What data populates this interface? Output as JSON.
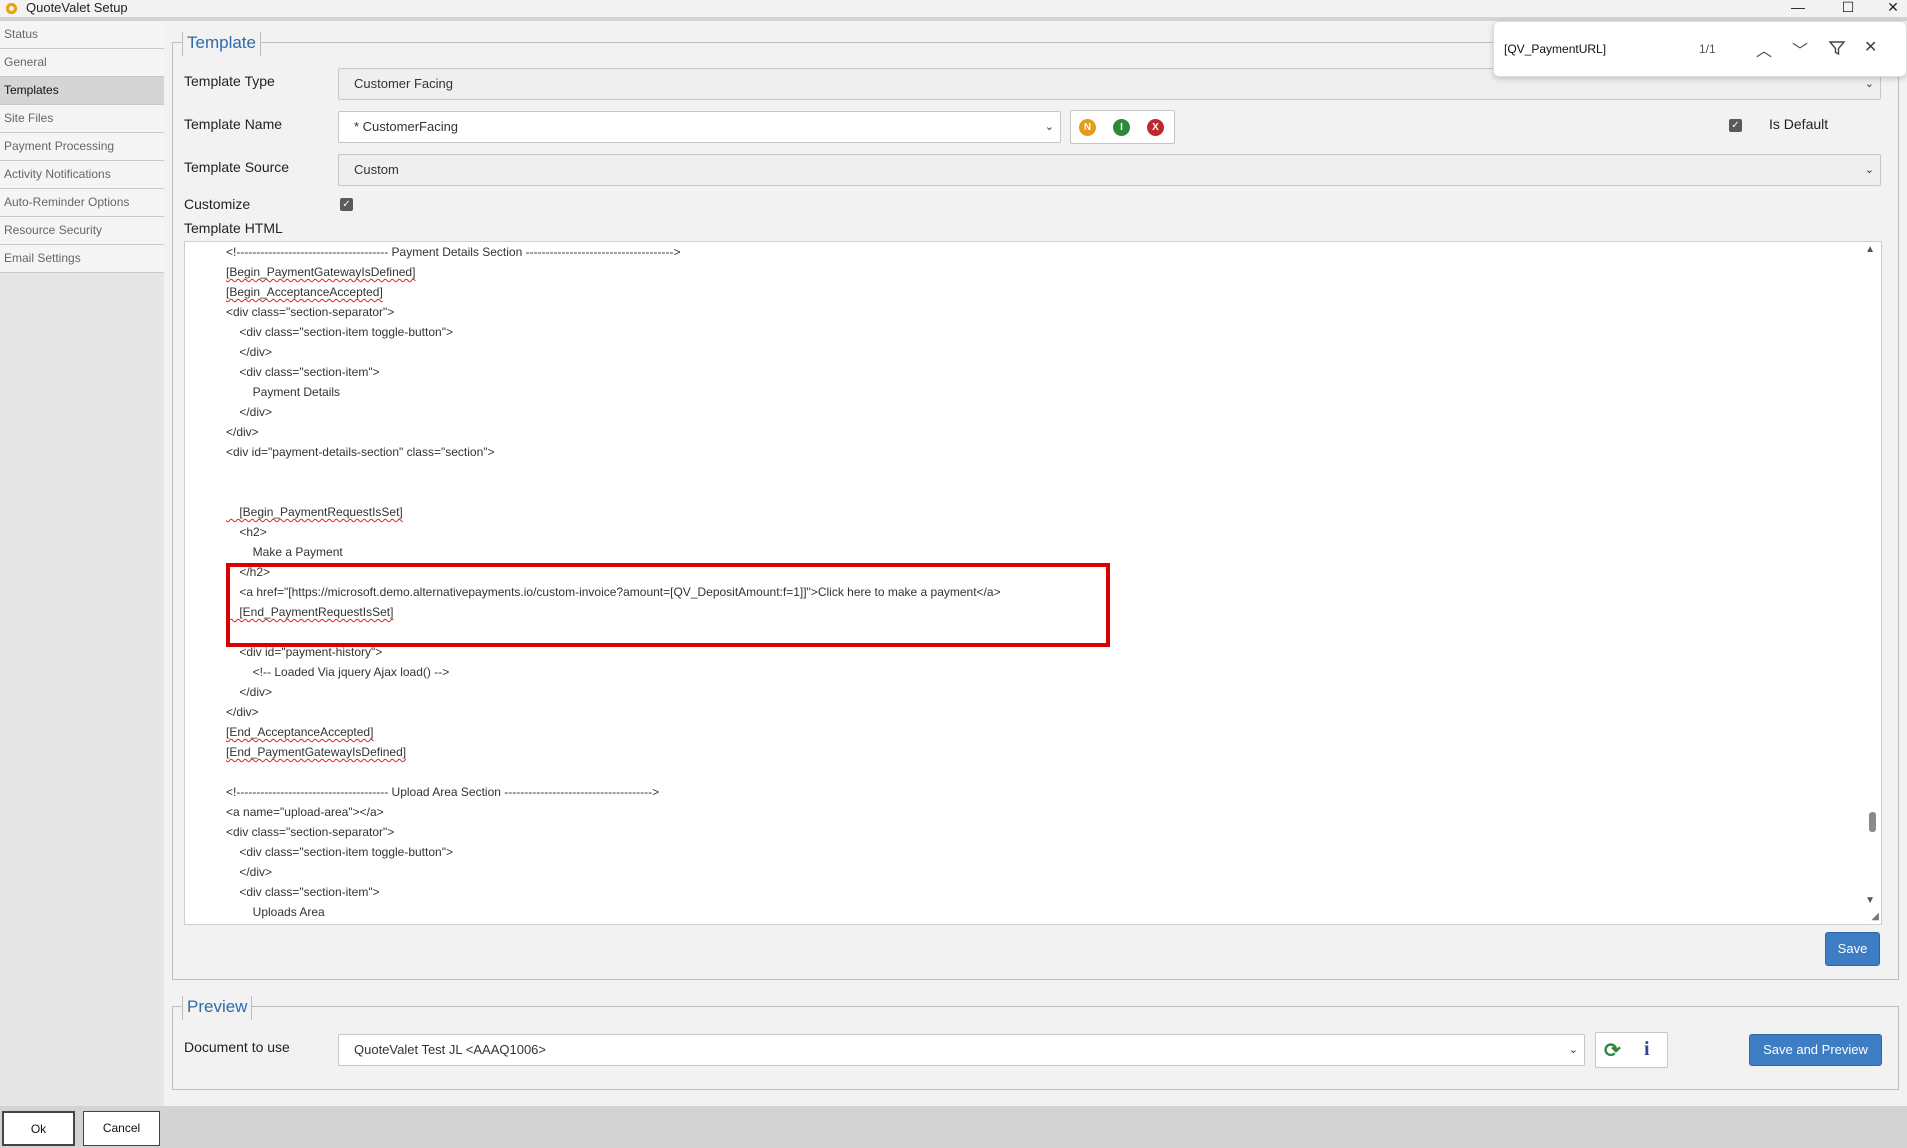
{
  "window": {
    "title": "QuoteValet Setup",
    "minimize": "—",
    "maximize": "☐",
    "close": "✕"
  },
  "sidebar": {
    "items": [
      {
        "label": "Status"
      },
      {
        "label": "General"
      },
      {
        "label": "Templates"
      },
      {
        "label": "Site Files"
      },
      {
        "label": "Payment Processing"
      },
      {
        "label": "Activity Notifications"
      },
      {
        "label": "Auto-Reminder Options"
      },
      {
        "label": "Resource Security"
      },
      {
        "label": "Email Settings"
      }
    ]
  },
  "template": {
    "legend": "Template",
    "type_label": "Template Type",
    "type_value": "Customer Facing",
    "name_label": "Template Name",
    "name_value": "* CustomerFacing",
    "btn_new": "N",
    "btn_info": "I",
    "btn_delete": "X",
    "is_default_label": "Is Default",
    "source_label": "Template Source",
    "source_value": "Custom",
    "customize_label": "Customize",
    "html_label": "Template HTML",
    "save_label": "Save"
  },
  "code": {
    "lines": [
      "<!-------------------------------------- Payment Details Section ------------------------------------->",
      "[Begin_PaymentGatewayIsDefined]",
      "[Begin_AcceptanceAccepted]",
      "<div class=\"section-separator\">",
      "    <div class=\"section-item toggle-button\">",
      "    </div>",
      "    <div class=\"section-item\">",
      "        Payment Details",
      "    </div>",
      "</div>",
      "<div id=\"payment-details-section\" class=\"section\">",
      "",
      "",
      "    [Begin_PaymentRequestIsSet]",
      "    <h2>",
      "        Make a Payment",
      "    </h2>",
      "    <a href=\"[https://microsoft.demo.alternativepayments.io/custom-invoice?amount=[QV_DepositAmount:f=1]]\">Click here to make a payment</a>",
      "    [End_PaymentRequestIsSet]",
      "",
      "    <div id=\"payment-history\">",
      "        <!-- Loaded Via jquery Ajax load() -->",
      "    </div>",
      "</div>",
      "[End_AcceptanceAccepted]",
      "[End_PaymentGatewayIsDefined]",
      "",
      "<!-------------------------------------- Upload Area Section ------------------------------------->",
      "<a name=\"upload-area\"></a>",
      "<div class=\"section-separator\">",
      "    <div class=\"section-item toggle-button\">",
      "    </div>",
      "    <div class=\"section-item\">",
      "        Uploads Area"
    ]
  },
  "preview": {
    "legend": "Preview",
    "doc_label": "Document to use",
    "doc_value": "QuoteValet Test JL <AAAQ1006>",
    "refresh_icon": "⟳",
    "info_icon": "i",
    "save_preview_label": "Save and Preview"
  },
  "find": {
    "query": "[QV_PaymentURL]",
    "count": "1/1"
  },
  "footer": {
    "ok": "Ok",
    "cancel": "Cancel"
  }
}
